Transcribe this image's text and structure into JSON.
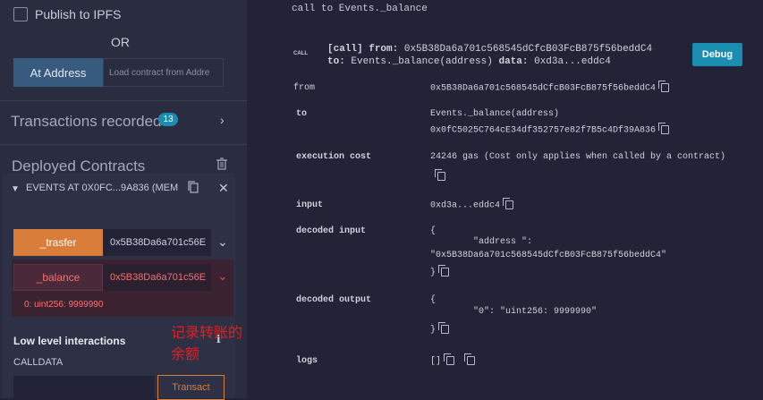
{
  "left": {
    "publish_label": "Publish to IPFS",
    "or_label": "OR",
    "at_address_label": "At Address",
    "load_placeholder": "Load contract from Addre",
    "transactions_title": "Transactions recorded",
    "transactions_count": "13",
    "deployed_title": "Deployed Contracts",
    "instance_title": "EVENTS AT 0X0FC...9A836 (MEM",
    "functions": [
      {
        "label": "_trasfer",
        "value": "0x5B38Da6a701c56E",
        "color": "#d97e3a"
      },
      {
        "label": "_balance",
        "value": "0x5B38Da6a701c56E",
        "color": "#e44a4a"
      }
    ],
    "balance_output": "0: uint256: 9999990",
    "annotation": "记录转账的余额",
    "low_level_title": "Low level interactions",
    "calldata_label": "CALLDATA",
    "transact_label": "Transact"
  },
  "right": {
    "call_line": "call to Events._balance",
    "call_tag": "CALL",
    "call_bracket": "[call]",
    "from_key": "from:",
    "from_val": "0x5B38Da6a701c568545dCfcB03FcB875f56beddC4",
    "to_key": "to:",
    "to_val": "Events._balance(address)",
    "data_key": "data:",
    "data_val": "0xd3a...eddc4",
    "debug_label": "Debug",
    "rows": {
      "from_k": "from",
      "from_v": "0x5B38Da6a701c568545dCfcB03FcB875f56beddC4",
      "to_k": "to",
      "to_v1": "Events._balance(address)",
      "to_v2": "0x0fC5025C764cE34df352757e82f7B5c4Df39A836",
      "cost_k": "execution cost",
      "cost_v": "24246 gas (Cost only applies when called by a contract)",
      "input_k": "input",
      "input_v": "0xd3a...eddc4",
      "dinput_k": "decoded input",
      "dinput_open": "{",
      "dinput_line1": "\"address \":",
      "dinput_line2": "\"0x5B38Da6a701c568545dCfcB03FcB875f56beddC4\"",
      "dinput_close": "}",
      "doutput_k": "decoded output",
      "doutput_open": "{",
      "doutput_line1": "\"0\": \"uint256: 9999990\"",
      "doutput_close": "}",
      "logs_k": "logs",
      "logs_v": "[]"
    }
  },
  "colors": {
    "accent": "#1a8db0",
    "orange": "#d97e3a",
    "red": "#e44a4a",
    "blue_btn": "#375a7f"
  }
}
